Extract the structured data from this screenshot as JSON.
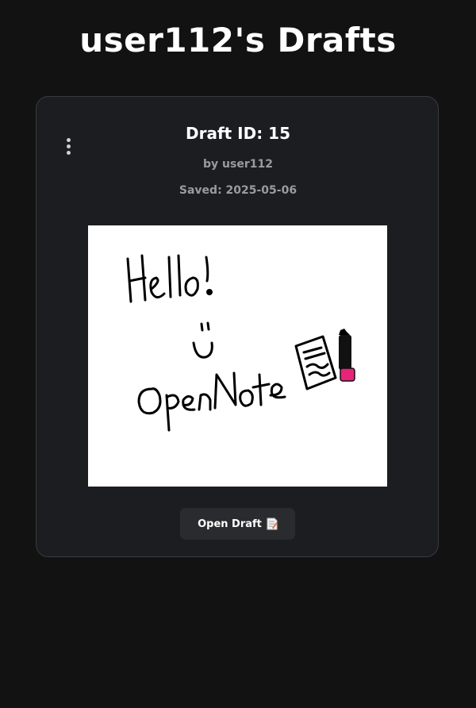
{
  "page": {
    "title": "user112's Drafts"
  },
  "draft": {
    "title": "Draft ID: 15",
    "author": "by user112",
    "saved": "Saved: 2025-05-06",
    "open_label": "Open Draft",
    "open_icon": "memo-icon",
    "menu_icon": "kebab-menu-icon",
    "thumbnail": {
      "handwritten_text": [
        "Hello!",
        "OpenNote"
      ]
    }
  },
  "colors": {
    "background": "#121212",
    "card": "#1c1d21",
    "card_border": "#3a3b40",
    "muted_text": "#9a9ba0",
    "button": "#2a2b2f",
    "sketch_ink": "#000000",
    "sketch_accent": "#e8237a"
  }
}
